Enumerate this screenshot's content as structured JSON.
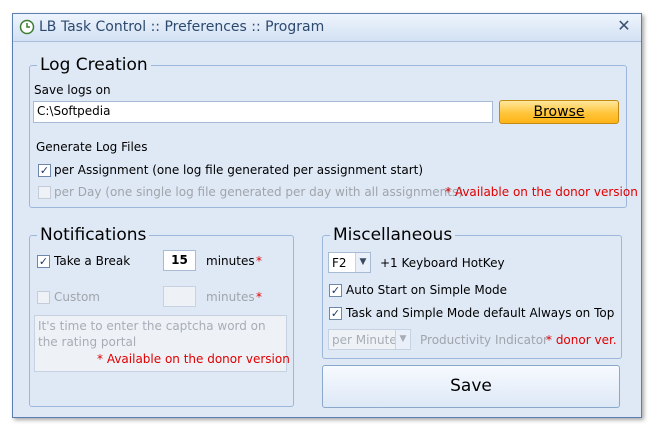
{
  "window": {
    "title": "LB Task Control :: Preferences :: Program",
    "close_glyph": "✕"
  },
  "log_creation": {
    "legend": "Log Creation",
    "save_logs_label": "Save logs on",
    "path_value": "C:\\Softpedia",
    "browse_label": "Browse",
    "generate_label": "Generate Log Files",
    "per_assignment": {
      "label": "per Assignment (one log file generated per assignment start)",
      "checked": true
    },
    "per_day": {
      "label": "per Day (one single log file generated per day with all assignments)",
      "checked": false
    },
    "donor_note": "* Available on the donor version"
  },
  "notifications": {
    "legend": "Notifications",
    "take_break": {
      "label": "Take a Break",
      "checked": true,
      "value": "15",
      "unit": "minutes",
      "asterisk": "*"
    },
    "custom": {
      "label": "Custom",
      "checked": false,
      "value": "",
      "unit": "minutes",
      "asterisk": "*"
    },
    "message": "It's time to enter the captcha word on the rating portal",
    "donor_note": "* Available on the donor version"
  },
  "misc": {
    "legend": "Miscellaneous",
    "hotkey": {
      "value": "F2",
      "label": "+1 Keyboard HotKey"
    },
    "auto_start": {
      "label": "Auto Start on Simple Mode",
      "checked": true
    },
    "always_top": {
      "label": "Task and Simple Mode default Always on Top",
      "checked": true
    },
    "productivity": {
      "select_value": "per Minute",
      "label": "Productivity Indicator",
      "donor_note": "* donor ver."
    }
  },
  "save_label": "Save",
  "icons": {
    "app": "task-clock-icon",
    "check": "checkmark-icon",
    "dropdown": "chevron-down-icon",
    "close": "close-icon"
  },
  "colors": {
    "accent_browse": "#ffc53b",
    "donor_red": "#e00000",
    "panel_bg": "#dfe9f6"
  },
  "glyphs": {
    "check": "✓",
    "arrow": "▼"
  }
}
